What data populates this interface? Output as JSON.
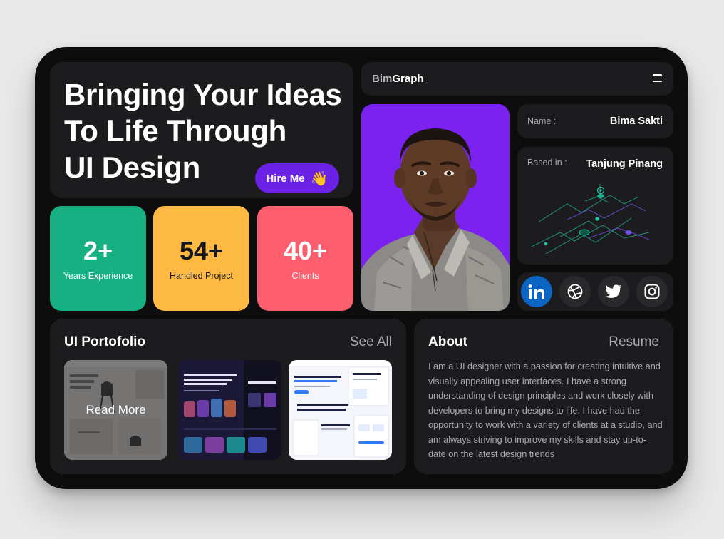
{
  "hero": {
    "title_line1": "Bringing Your Ideas",
    "title_line2": "To Life Through",
    "title_line3": "UI Design",
    "hire_label": "Hire Me",
    "hire_emoji": "👋"
  },
  "stats": [
    {
      "value": "2+",
      "label": "Years Experience"
    },
    {
      "value": "54+",
      "label": "Handled Project"
    },
    {
      "value": "40+",
      "label": "Clients"
    }
  ],
  "header": {
    "brand_a": "Bim",
    "brand_b": "Graph",
    "menu_icon": "hamburger-menu-icon"
  },
  "profile": {
    "name_label": "Name :",
    "name_value": "Bima Sakti",
    "location_label": "Based in :",
    "location_value": "Tanjung Pinang"
  },
  "social": [
    "linkedin-icon",
    "dribbble-icon",
    "twitter-icon",
    "instagram-icon"
  ],
  "portfolio": {
    "title": "UI Portofolio",
    "see_all": "See All",
    "read_more": "Read More",
    "thumbs": [
      {
        "name": "furniture-store-design"
      },
      {
        "name": "nft-marketplace-design",
        "heading": "Discover the Future of Collectibles with our NFT Marketplace"
      },
      {
        "name": "auto-comments-saas-design",
        "heading": "Save Time and Resources With Assistant Auto Comments"
      }
    ]
  },
  "about": {
    "title": "About",
    "resume": "Resume",
    "text": "I am a UI designer with a passion for creating intuitive and visually appealing user interfaces. I have a strong understanding of design principles and work closely with developers to bring my designs to life. I have had the opportunity to work with a variety of clients at a studio, and am always striving to improve my skills and stay up-to-date on the latest design trends"
  },
  "colors": {
    "accent_purple": "#6c22e6",
    "photo_bg": "#7b21f0",
    "stat_green": "#17b083",
    "stat_yellow": "#fdb942",
    "stat_red": "#fd5e6e",
    "card_bg": "#1c1c1e",
    "linkedin_blue": "#0a66c2"
  }
}
